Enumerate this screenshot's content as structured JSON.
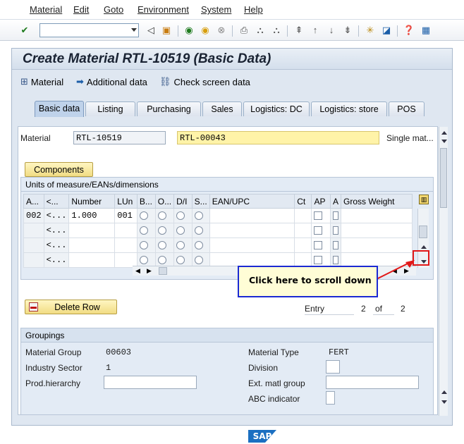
{
  "menu": [
    "Material",
    "Edit",
    "Goto",
    "Environment",
    "System",
    "Help"
  ],
  "window_title": "Create Material RTL-10519 (Basic Data)",
  "app_toolbar": {
    "material": "Material",
    "additional_data": "Additional data",
    "check_screen": "Check screen data"
  },
  "tabs": [
    "Basic data",
    "Listing",
    "Purchasing",
    "Sales",
    "Logistics: DC",
    "Logistics: store",
    "POS"
  ],
  "active_tab": "Basic data",
  "header": {
    "material_label": "Material",
    "material_value": "RTL-10519",
    "ref_value": "RTL-00043",
    "single_mat": "Single mat..."
  },
  "components_button": "Components",
  "uom_section": {
    "title": "Units of measure/EANs/dimensions",
    "columns": [
      "A...",
      "<...",
      "Number",
      "LUn",
      "B...",
      "O...",
      "D/I",
      "S...",
      "EAN/UPC",
      "Ct",
      "AP",
      "A",
      "Gross Weight"
    ],
    "rows": [
      {
        "a": "002",
        "b": "<...",
        "number": "1.000",
        "lun": "001"
      },
      {
        "a": "",
        "b": "<...",
        "number": "",
        "lun": ""
      },
      {
        "a": "",
        "b": "<...",
        "number": "",
        "lun": ""
      },
      {
        "a": "",
        "b": "<...",
        "number": "",
        "lun": ""
      }
    ]
  },
  "delete_row": "Delete Row",
  "entry": {
    "label": "Entry",
    "current": "2",
    "of": "of",
    "total": "2"
  },
  "groupings": {
    "title": "Groupings",
    "material_group_label": "Material Group",
    "material_group_value": "00603",
    "industry_sector_label": "Industry Sector",
    "industry_sector_value": "1",
    "prod_hierarchy_label": "Prod.hierarchy",
    "material_type_label": "Material Type",
    "material_type_value": "FERT",
    "division_label": "Division",
    "ext_matl_group_label": "Ext. matl group",
    "abc_indicator_label": "ABC indicator"
  },
  "callout": "Click here to scroll down",
  "sap_logo": "SAP",
  "colors": {
    "callout_border": "#1b2ad3",
    "callout_bg": "#fffdd6",
    "highlight": "#e11818",
    "title_bg": "#d4dfec"
  }
}
